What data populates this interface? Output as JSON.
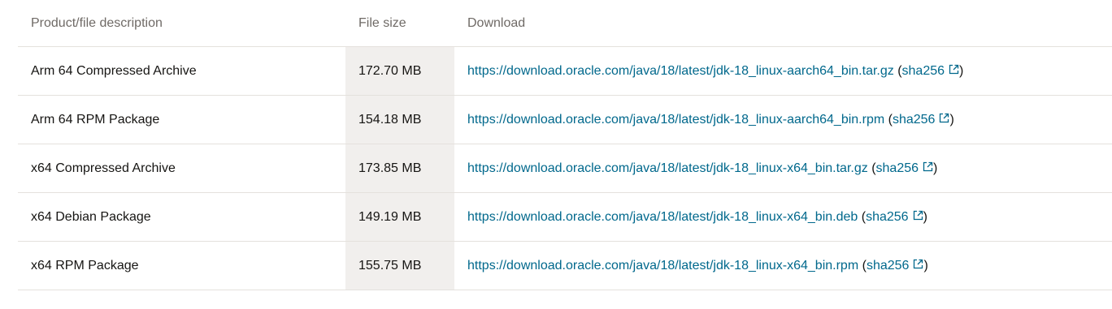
{
  "table": {
    "headers": {
      "description": "Product/file description",
      "size": "File size",
      "download": "Download"
    },
    "rows": [
      {
        "description": "Arm 64 Compressed Archive",
        "size": "172.70 MB",
        "url": "https://download.oracle.com/java/18/latest/jdk-18_linux-aarch64_bin.tar.gz",
        "sha_label": "sha256"
      },
      {
        "description": "Arm 64 RPM Package",
        "size": "154.18 MB",
        "url": "https://download.oracle.com/java/18/latest/jdk-18_linux-aarch64_bin.rpm",
        "sha_label": "sha256"
      },
      {
        "description": "x64 Compressed Archive",
        "size": "173.85 MB",
        "url": "https://download.oracle.com/java/18/latest/jdk-18_linux-x64_bin.tar.gz",
        "sha_label": "sha256"
      },
      {
        "description": "x64 Debian Package",
        "size": "149.19 MB",
        "url": "https://download.oracle.com/java/18/latest/jdk-18_linux-x64_bin.deb",
        "sha_label": "sha256"
      },
      {
        "description": "x64 RPM Package",
        "size": "155.75 MB",
        "url": "https://download.oracle.com/java/18/latest/jdk-18_linux-x64_bin.rpm",
        "sha_label": "sha256"
      }
    ]
  },
  "icons": {
    "external_link": "external-link-icon"
  },
  "colors": {
    "link": "#00688c",
    "header_text": "#6f6a66",
    "size_column_bg": "#f1efed",
    "row_border": "#e4e1dd"
  }
}
